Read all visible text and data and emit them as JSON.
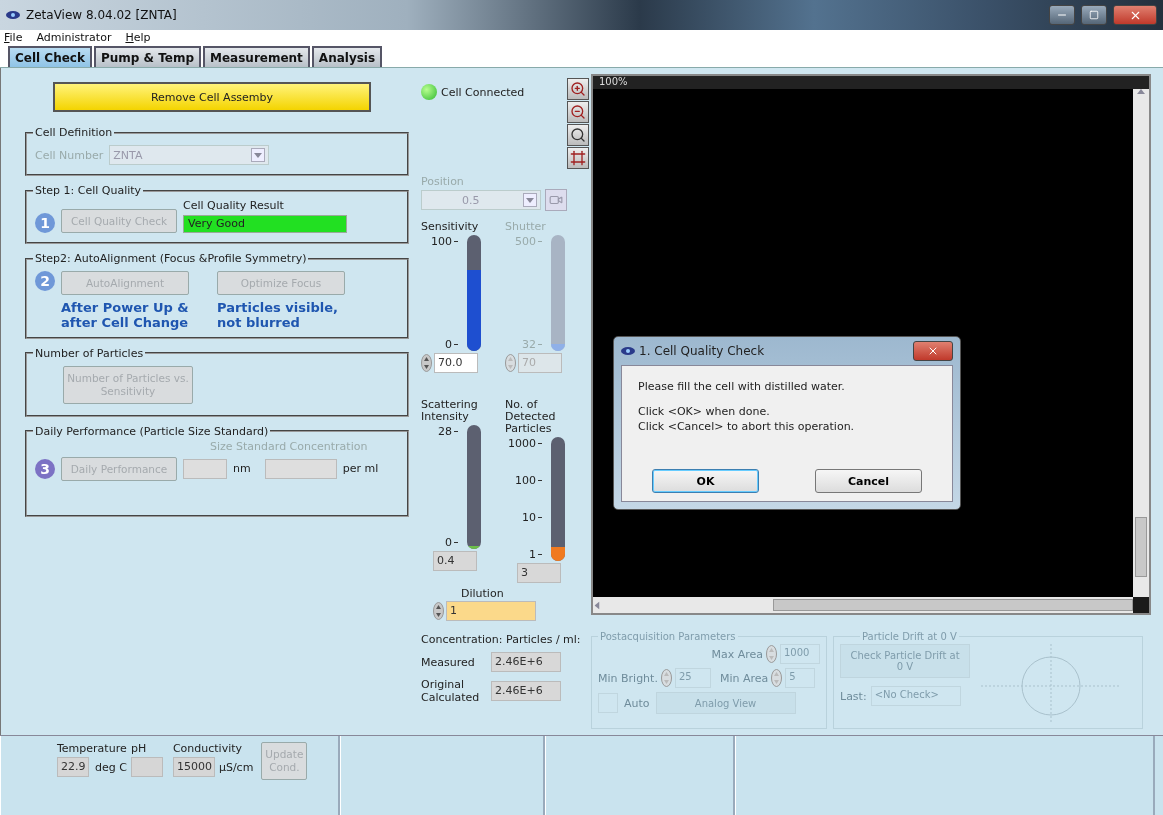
{
  "window": {
    "title": "ZetaView 8.04.02 [ZNTA]"
  },
  "menu": [
    {
      "label": "File",
      "underline_first": true
    },
    {
      "label": "Administrator",
      "underline_first": false
    },
    {
      "label": "Help",
      "underline_first": true
    }
  ],
  "tabs": [
    {
      "label": "Cell Check",
      "selected": true
    },
    {
      "label": "Pump & Temp",
      "selected": false
    },
    {
      "label": "Measurement",
      "selected": false
    },
    {
      "label": "Analysis",
      "selected": false
    }
  ],
  "remove_button": {
    "label": "Remove Cell Assemby"
  },
  "cell_definition": {
    "title": "Cell Definition",
    "label": "Cell Number",
    "value": "ZNTA",
    "disabled": true
  },
  "step1": {
    "title": "Step 1: Cell Quality",
    "badge": "1",
    "button": {
      "label": "Cell Quality Check",
      "disabled": true
    },
    "result_label": "Cell Quality Result",
    "result": "Very Good"
  },
  "step2": {
    "title": "Step2: AutoAlignment (Focus &Profile Symmetry)",
    "badge": "2",
    "buttons": [
      {
        "label": "AutoAlignment",
        "disabled": true,
        "note": [
          "After Power Up &",
          "after Cell Change"
        ]
      },
      {
        "label": "Optimize Focus",
        "disabled": true,
        "note": [
          "Particles visible,",
          "not blurred"
        ]
      }
    ]
  },
  "particles": {
    "title": "Number of Particles",
    "button": {
      "label": "Number of Particles vs. Sensitivity",
      "disabled": true
    }
  },
  "daily": {
    "title": "Daily Performance (Particle Size Standard)",
    "badge": "3",
    "button": {
      "label": "Daily Performance",
      "disabled": true
    },
    "concentration_label": "Size Standard Concentration",
    "units": [
      "nm",
      "per ml"
    ]
  },
  "connection": {
    "label": "Cell Connected",
    "on": true
  },
  "position": {
    "label": "Position",
    "value": "0.5",
    "disabled": true
  },
  "meters": [
    {
      "label": "Sensitivity",
      "disabled": false,
      "level": 0.7,
      "color": "#1e4fd0",
      "scale": [
        "100",
        "0"
      ],
      "value": "70.0",
      "kind": "spin"
    },
    {
      "label": "Shutter",
      "disabled": true,
      "level": 0.06,
      "color": "#8fb0e8",
      "scale": [
        "500",
        "32"
      ],
      "value": "70",
      "kind": "spin"
    },
    {
      "label": "Scattering Intensity",
      "disabled": false,
      "level": 0.03,
      "color": "#6cc04a",
      "scale": [
        "28",
        "0"
      ],
      "value": "0.4",
      "kind": "readout"
    },
    {
      "label": "No. of Detected Particles",
      "disabled": false,
      "level": 0.12,
      "color": "#f07a20",
      "scale": [
        "1000",
        "100",
        "10",
        "1"
      ],
      "value": "3",
      "kind": "readout"
    }
  ],
  "dilution": {
    "label": "Dilution",
    "value": "1"
  },
  "concentration": {
    "title": "Concentration: Particles / ml:",
    "rows": [
      {
        "label": "Measured",
        "value": "2.46E+6"
      },
      {
        "label": "Original Calculated",
        "value": "2.46E+6"
      }
    ]
  },
  "video": {
    "zoom": "100%"
  },
  "dialog": {
    "title": "1. Cell Quality Check",
    "message": "Please fill the cell with distilled water.",
    "instructions": [
      "Click <OK> when done.",
      "Click <Cancel> to abort this operation."
    ],
    "buttons": [
      {
        "label": "OK",
        "default": true
      },
      {
        "label": "Cancel",
        "default": false
      }
    ]
  },
  "postacquisition": {
    "title": "Postacquisition Parameters",
    "max_area": {
      "label": "Max Area",
      "value": "1000"
    },
    "min_bright": {
      "label": "Min Bright.",
      "value": "25"
    },
    "min_area": {
      "label": "Min Area",
      "value": "5"
    },
    "auto": {
      "label": "Auto",
      "checked": false
    },
    "button": "Analog View"
  },
  "drift": {
    "title": "Particle Drift at 0 V",
    "button": "Check Particle Drift at 0 V",
    "last_label": "Last:",
    "last_value": "<No Check>"
  },
  "status_bar": {
    "temperature_label": "Temperature",
    "temperature": "22.9",
    "temperature_unit": "deg C",
    "ph_label": "pH",
    "conductivity_label": "Conductivity",
    "conductivity": "15000",
    "conductivity_unit": "µS/cm",
    "button": {
      "label": "Update Cond.",
      "disabled": true
    }
  }
}
